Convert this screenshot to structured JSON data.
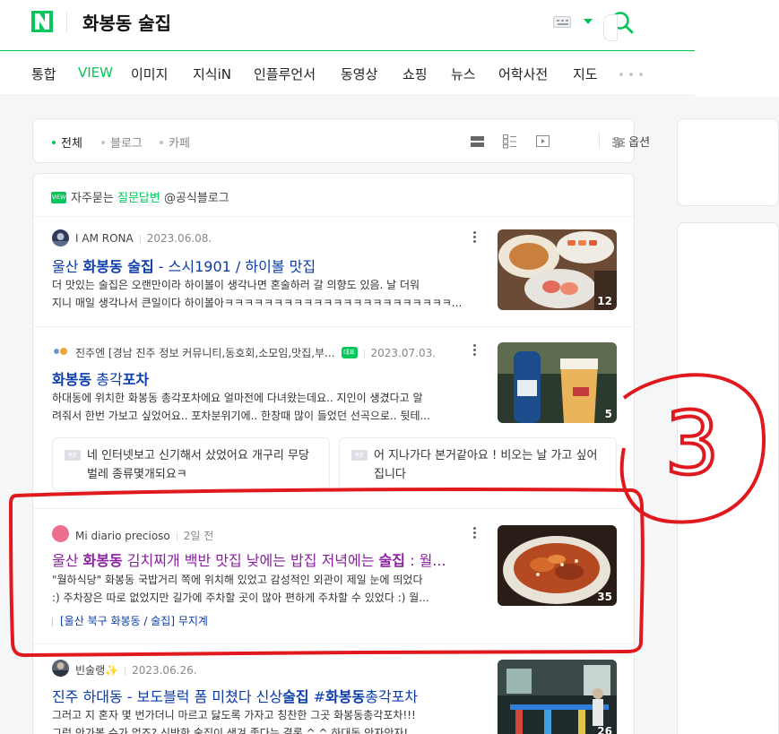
{
  "header": {
    "logo": "N",
    "query": "화봉동 술집",
    "icons": {
      "keyboard": "keyboard-icon",
      "search": "search-icon"
    },
    "accent_color": "#03c75a"
  },
  "tabs": [
    {
      "label": "통합",
      "active": false
    },
    {
      "label": "VIEW",
      "active": true
    },
    {
      "label": "이미지",
      "active": false
    },
    {
      "label": "지식iN",
      "active": false
    },
    {
      "label": "인플루언서",
      "active": false
    },
    {
      "label": "동영상",
      "active": false
    },
    {
      "label": "쇼핑",
      "active": false
    },
    {
      "label": "뉴스",
      "active": false
    },
    {
      "label": "어학사전",
      "active": false
    },
    {
      "label": "지도",
      "active": false
    }
  ],
  "filter": {
    "items": [
      {
        "label": "전체",
        "active": true
      },
      {
        "label": "블로그",
        "active": false
      },
      {
        "label": "카페",
        "active": false
      }
    ],
    "option_label": "옵션"
  },
  "qa": {
    "prefix": "자주묻는",
    "highlight": "질문답변",
    "suffix": "@공식블로그",
    "badge": "VIEW"
  },
  "results": [
    {
      "author": "I AM RONA",
      "date": "2023.06.08.",
      "title": "울산 화봉동 술집 - 스시1901 / 하이볼 맛집",
      "desc_1": "더 맛있는 술집은 오랜만이라 하이볼이 생각나면 혼술하러 갈 의향도 있음. 날 더워",
      "desc_2": "지니 매일 생각나서 큰일이다 하이볼아ㅋㅋㅋㅋㅋㅋㅋㅋㅋㅋㅋㅋㅋㅋㅋㅋㅋㅋㅋㅋㅋㅋㅋ...",
      "thumb_count": "12"
    },
    {
      "author": "진주엔 [경남 진주 정보 커뮤니티,동호회,소모임,맛집,부...",
      "badge": "대표",
      "date": "2023.07.03.",
      "title": "화봉동 총각포차",
      "desc_1": "하대동에 위치한 화봉동 총각포차에요 얼마전에 다녀왔는데요.. 지인이 생겼다고 알",
      "desc_2": "려줘서 한번 가보고 싶었어요.. 포차분위기에.. 한창때 많이 들었던 선곡으로.. 뒷테...",
      "thumb_count": "5",
      "replies": [
        {
          "tag": "RE",
          "text": "네 인터넷보고 신기해서 샀었어요 개구리 무당벌레 종류몇개되요ㅋ"
        },
        {
          "tag": "RE",
          "text": "어 지나가다 본거같아요 ! 비오는 날 가고 싶어집니다"
        }
      ]
    },
    {
      "author": "Mi diario precioso",
      "date": "2일 전",
      "title": "울산 화봉동 김치찌개 백반 맛집 낮에는 밥집 저녁에는 술집 : 월...",
      "desc_1": "\"월하식당\" 화봉동 국밥거리 쪽에 위치해 있었고 감성적인 외관이 제일 눈에 띄었다",
      "desc_2": ":) 주차장은 따로 없었지만 길가에 주차할 곳이 많아 편하게 주차할 수 있었다 :) 월...",
      "thumb_count": "35",
      "tag_line": "[울산 북구 화봉동 / 술집] 무지계"
    },
    {
      "author": "빈술랭✨",
      "date": "2023.06.26.",
      "title": "진주 하대동 - 보도블럭 폼 미쳤다 신상술집 #화봉동총각포차",
      "desc_1": "그러고 지 혼자 몇 번가더니 마르고 닳도록 가자고 칭찬한 그곳 화봉동총각포차!!!",
      "desc_2": "그럼 안가볼 수가 없죠? 신박한 술집이 생겨 좋다는 결론 ^ ^ 하대동 안자안자!",
      "thumb_count": "26"
    }
  ],
  "annotation": {
    "label": "3",
    "color": "#e0191e"
  }
}
